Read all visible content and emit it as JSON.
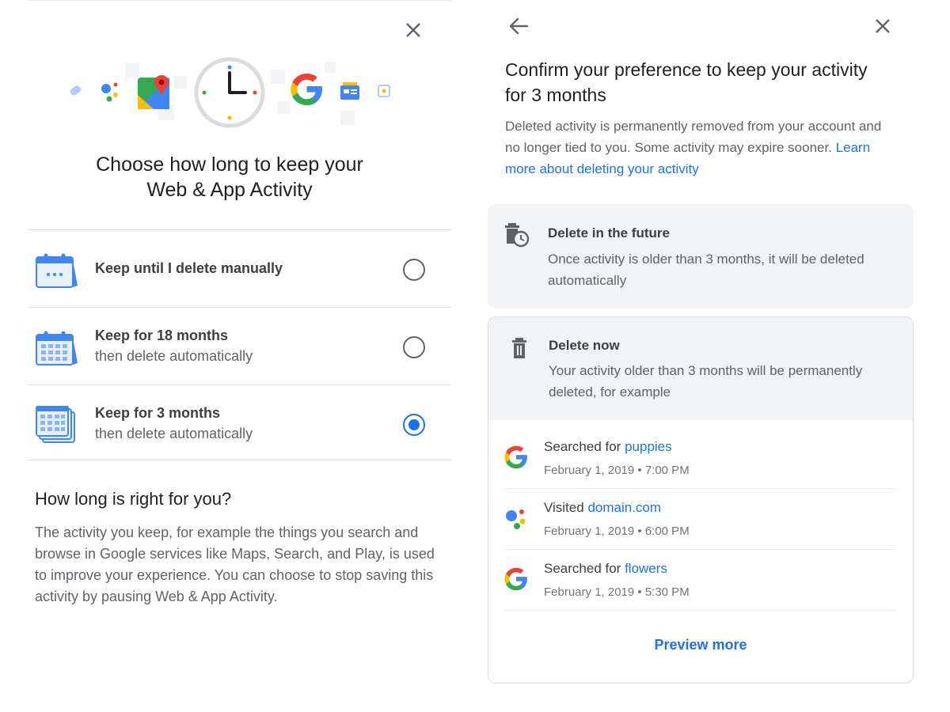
{
  "left": {
    "title_line1": "Choose how long to keep your",
    "title_line2": "Web & App Activity",
    "options": [
      {
        "title": "Keep until I delete manually",
        "subtitle": "",
        "selected": false
      },
      {
        "title": "Keep for 18 months",
        "subtitle": "then delete automatically",
        "selected": false
      },
      {
        "title": "Keep for 3 months",
        "subtitle": "then delete automatically",
        "selected": true
      }
    ],
    "info_title": "How long is right for you?",
    "info_body": "The activity you keep, for example the things you search and browse in Google services like Maps, Search, and Play, is used to improve your experience. You can choose to stop saving this activity by pausing Web & App Activity."
  },
  "right": {
    "title": "Confirm your preference to keep your activity for 3 months",
    "description": "Deleted activity is permanently removed from your account and no longer tied to you. Some activity may expire sooner.",
    "learn_more": "Learn more about deleting your activity",
    "future_card": {
      "title": "Delete in the future",
      "body": "Once activity is older than 3 months, it will be deleted automatically"
    },
    "now_card": {
      "title": "Delete now",
      "body": "Your activity older than 3 months will be permanently deleted, for example"
    },
    "activities": [
      {
        "icon": "google-icon",
        "prefix": "Searched for",
        "link": "puppies",
        "time": "February 1, 2019 • 7:00 PM"
      },
      {
        "icon": "assistant-icon",
        "prefix": "Visited",
        "link": "domain.com",
        "time": "February 1, 2019 • 6:00 PM"
      },
      {
        "icon": "google-icon",
        "prefix": "Searched for",
        "link": "flowers",
        "time": "February 1, 2019 • 5:30 PM"
      }
    ],
    "preview_more": "Preview more"
  },
  "colors": {
    "accent": "#1a73e8",
    "text_primary": "#202124",
    "text_secondary": "#5f6368",
    "card_bg": "#f1f3f4",
    "divider": "#dadce0"
  }
}
